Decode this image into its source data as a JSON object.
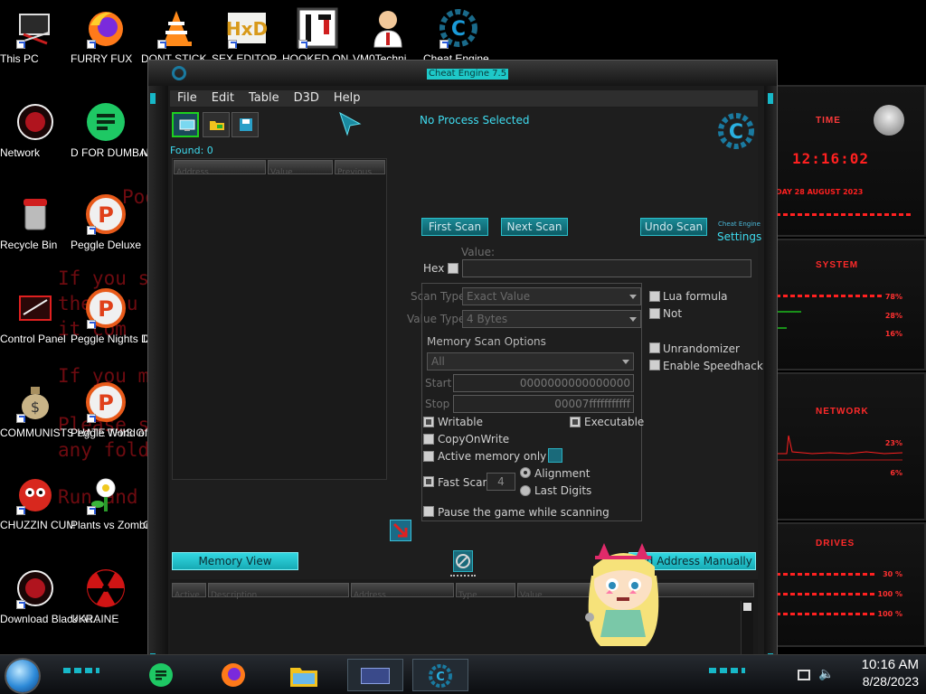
{
  "desktop": {
    "background_text": [
      "Poo",
      "If you s",
      "the you",
      "it com",
      "If you m",
      "Please s",
      "any fold",
      "Run and"
    ],
    "icons": [
      {
        "label": "This PC",
        "icon": "computer-icon"
      },
      {
        "label": "Network",
        "icon": "network-icon"
      },
      {
        "label": "Recycle Bin",
        "icon": "recycle-bin-icon"
      },
      {
        "label": "Control Panel",
        "icon": "control-panel-icon"
      },
      {
        "label": "COMMUNISTS HATE THIS G...",
        "icon": "money-bag-icon"
      },
      {
        "label": "CHUZZIN CUM",
        "icon": "chuzzle-icon"
      },
      {
        "label": "Download Black Ali...",
        "icon": "alien-icon"
      },
      {
        "label": "FURRY FUX",
        "icon": "firefox-icon"
      },
      {
        "label": "D FOR DUMBASS",
        "icon": "feedly-icon"
      },
      {
        "label": "Peggle Deluxe",
        "icon": "peggle-icon"
      },
      {
        "label": "Peggle Nights Deluxe",
        "icon": "peggle-icon"
      },
      {
        "label": "Peggle World of Warcraft ...",
        "icon": "peggle-icon"
      },
      {
        "label": "Plants vs Zombies",
        "icon": "pvz-icon"
      },
      {
        "label": "UKRAINE",
        "icon": "radiation-icon"
      },
      {
        "label": "DONT STICK",
        "icon": "vlc-icon"
      },
      {
        "label": "SEX EDITOR",
        "icon": "hxd-icon"
      },
      {
        "label": "HOOKED ON",
        "icon": "hooked-icon"
      },
      {
        "label": "VM0Techni",
        "icon": "doctor-icon"
      },
      {
        "label": "Cheat Engine",
        "icon": "cheat-engine-icon"
      }
    ],
    "partial_labels": [
      "N",
      "D",
      "C"
    ]
  },
  "widgets": {
    "time": {
      "title": "TIME",
      "clock": "12:16:02",
      "date": "DAY 28 AUGUST 2023"
    },
    "system": {
      "title": "SYSTEM",
      "values": [
        "78%",
        "28%",
        "16%"
      ]
    },
    "network": {
      "title": "NETWORK",
      "values": [
        "23%",
        "6%"
      ]
    },
    "drives": {
      "title": "DRIVES",
      "values": [
        "30 %",
        "100 %",
        "100 %"
      ]
    }
  },
  "cheat_engine": {
    "title": "Cheat Engine 7.5",
    "menu": [
      "File",
      "Edit",
      "Table",
      "D3D",
      "Help"
    ],
    "process": "No Process Selected",
    "found": "Found: 0",
    "settings": "Settings",
    "logo_caption": "Cheat Engine",
    "found_columns": [
      "Address",
      "Value",
      "Previous"
    ],
    "buttons": {
      "first_scan": "First Scan",
      "next_scan": "Next Scan",
      "undo_scan": "Undo Scan",
      "memory_view": "Memory View",
      "add_address": "Add Address Manually"
    },
    "value_label": "Value:",
    "hex_label": "Hex",
    "scan_type_label": "Scan Type",
    "scan_type_value": "Exact Value",
    "value_type_label": "Value Type",
    "value_type_value": "4 Bytes",
    "lua_formula": "Lua formula",
    "not": "Not",
    "memory_scan_options": "Memory Scan Options",
    "region": "All",
    "start_label": "Start",
    "start_value": "0000000000000000",
    "stop_label": "Stop",
    "stop_value": "00007fffffffffff",
    "writable": "Writable",
    "executable": "Executable",
    "copy_on_write": "CopyOnWrite",
    "active_memory_only": "Active memory only",
    "fast_scan": "Fast Scan",
    "fast_scan_value": "4",
    "alignment": "Alignment",
    "last_digits": "Last Digits",
    "pause_game": "Pause the game while scanning",
    "unrandomizer": "Unrandomizer",
    "enable_speedhack": "Enable Speedhack",
    "address_columns": [
      "Active",
      "Description",
      "Address",
      "Type",
      "Value"
    ]
  },
  "taskbar": {
    "time": "10:16 AM",
    "date": "8/28/2023"
  },
  "colors": {
    "accent": "#1EC8C8",
    "widget_red": "#FF2A2A",
    "window_bg": "#1E1E1E"
  }
}
